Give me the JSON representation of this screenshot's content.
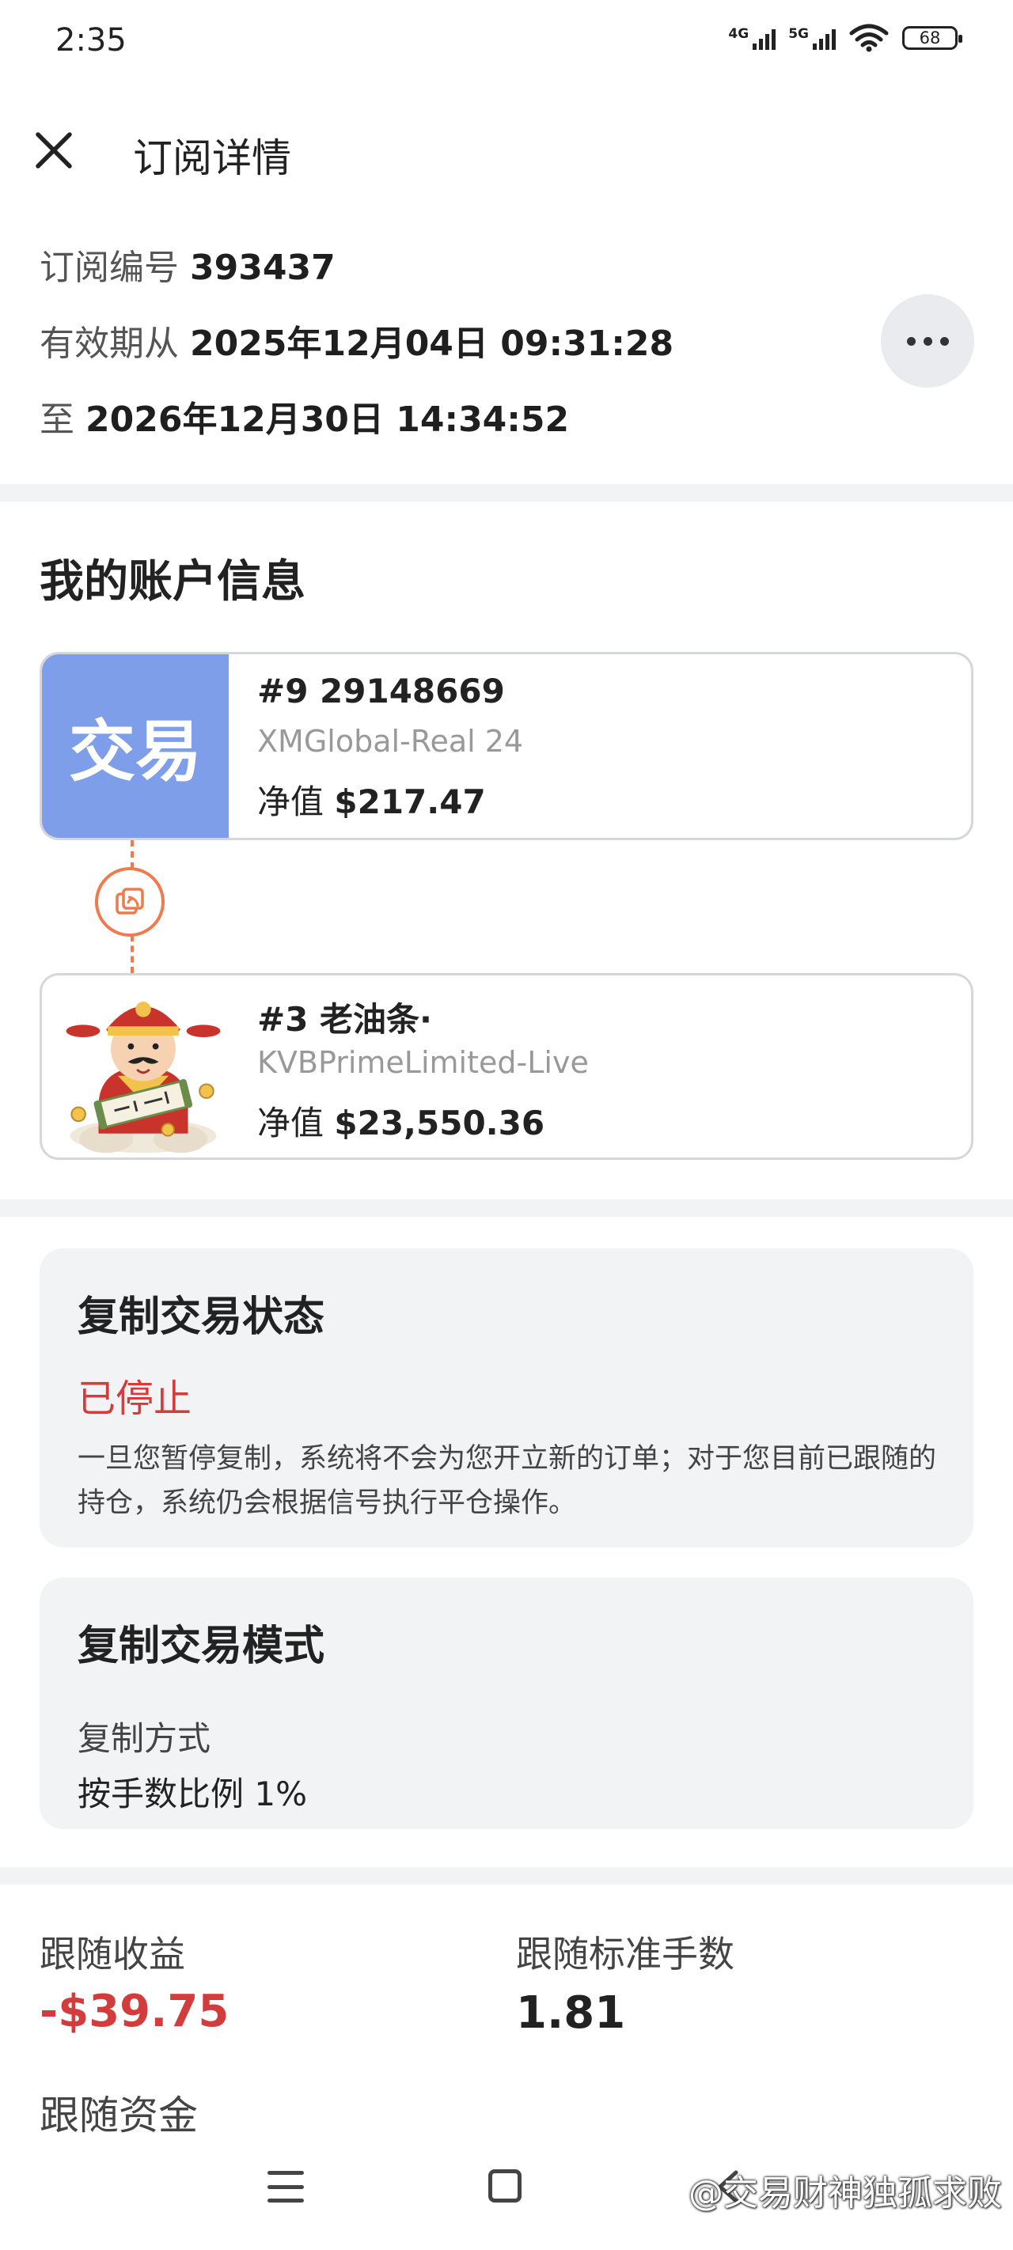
{
  "status_bar": {
    "time": "2:35",
    "net1": "4G",
    "net2": "5G",
    "battery": "68"
  },
  "header": {
    "title": "订阅详情",
    "close_icon": "close-icon"
  },
  "subscription": {
    "id_label": "订阅编号",
    "id_value": "393437",
    "valid_from_label": "有效期从",
    "valid_from_value": "2025年12月04日 09:31:28",
    "valid_to_label": "至",
    "valid_to_value": "2026年12月30日 14:34:52",
    "more_icon": "more-horizontal-icon"
  },
  "account_section": {
    "title": "我的账户信息",
    "my_account": {
      "badge": "交易",
      "title": "#9 29148669",
      "server": "XMGlobal-Real 24",
      "equity_label": "净值",
      "equity_value": "$217.47"
    },
    "link_icon": "copy-link-icon",
    "signal_account": {
      "avatar": "god-of-wealth-avatar",
      "title": "#3 老油条·",
      "server": "KVBPrimeLimited-Live",
      "equity_label": "净值",
      "equity_value": "$23,550.36"
    }
  },
  "copy_status": {
    "title": "复制交易状态",
    "status": "已停止",
    "status_color": "#d23c3c",
    "description": "一旦您暂停复制，系统将不会为您开立新的订单；对于您目前已跟随的持仓，系统仍会根据信号执行平仓操作。"
  },
  "copy_mode": {
    "title": "复制交易模式",
    "method_label": "复制方式",
    "method_value": "按手数比例 1%"
  },
  "stats": {
    "profit_label": "跟随收益",
    "profit_value": "-$39.75",
    "lots_label": "跟随标准手数",
    "lots_value": "1.81",
    "funds_label": "跟随资金"
  },
  "nav": {
    "menu_icon": "menu-icon",
    "home_icon": "home-icon",
    "back_icon": "back-icon"
  },
  "watermark": "@交易财神独孤求败"
}
